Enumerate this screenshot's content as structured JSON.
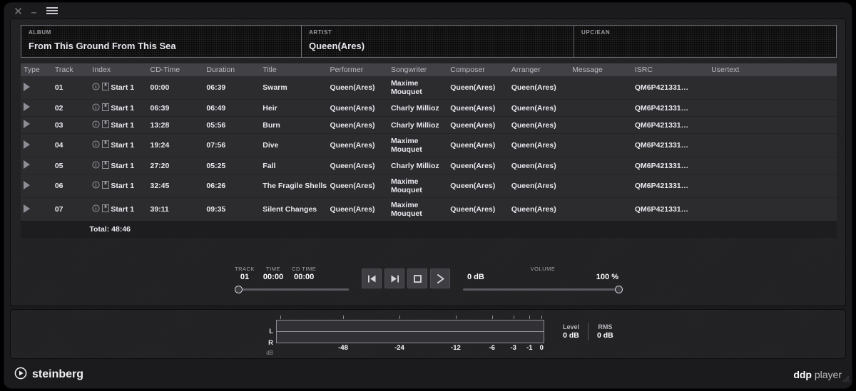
{
  "titlebar": {
    "close_icon": "close-icon",
    "minimize_icon": "minimize-icon",
    "menu_icon": "hamburger-menu-icon"
  },
  "meta": {
    "album": {
      "label": "ALBUM",
      "value": "From This Ground From This Sea"
    },
    "artist": {
      "label": "ARTIST",
      "value": "Queen(Ares)"
    },
    "upc": {
      "label": "UPC/EAN",
      "value": ""
    }
  },
  "table": {
    "columns": [
      "Type",
      "Track",
      "Index",
      "CD-Time",
      "Duration",
      "Title",
      "Performer",
      "Songwriter",
      "Composer",
      "Arranger",
      "Message",
      "ISRC",
      "Usertext"
    ],
    "rows": [
      {
        "track": "01",
        "index": "Start 1",
        "cdtime": "00:00",
        "duration": "06:39",
        "title": "Swarm",
        "performer": "Queen(Ares)",
        "songwriter": "Maxime Mouquet",
        "composer": "Queen(Ares)",
        "arranger": "Queen(Ares)",
        "message": "",
        "isrc": "QM6P421331…",
        "usertext": ""
      },
      {
        "track": "02",
        "index": "Start 1",
        "cdtime": "06:39",
        "duration": "06:49",
        "title": "Heir",
        "performer": "Queen(Ares)",
        "songwriter": "Charly Millioz",
        "composer": "Queen(Ares)",
        "arranger": "Queen(Ares)",
        "message": "",
        "isrc": "QM6P421331…",
        "usertext": ""
      },
      {
        "track": "03",
        "index": "Start 1",
        "cdtime": "13:28",
        "duration": "05:56",
        "title": "Burn",
        "performer": "Queen(Ares)",
        "songwriter": "Charly Millioz",
        "composer": "Queen(Ares)",
        "arranger": "Queen(Ares)",
        "message": "",
        "isrc": "QM6P421331…",
        "usertext": ""
      },
      {
        "track": "04",
        "index": "Start 1",
        "cdtime": "19:24",
        "duration": "07:56",
        "title": "Dive",
        "performer": "Queen(Ares)",
        "songwriter": "Maxime Mouquet",
        "composer": "Queen(Ares)",
        "arranger": "Queen(Ares)",
        "message": "",
        "isrc": "QM6P421331…",
        "usertext": ""
      },
      {
        "track": "05",
        "index": "Start 1",
        "cdtime": "27:20",
        "duration": "05:25",
        "title": "Fall",
        "performer": "Queen(Ares)",
        "songwriter": "Charly Millioz",
        "composer": "Queen(Ares)",
        "arranger": "Queen(Ares)",
        "message": "",
        "isrc": "QM6P421331…",
        "usertext": ""
      },
      {
        "track": "06",
        "index": "Start 1",
        "cdtime": "32:45",
        "duration": "06:26",
        "title": "The Fragile Shells",
        "performer": "Queen(Ares)",
        "songwriter": "Maxime Mouquet",
        "composer": "Queen(Ares)",
        "arranger": "Queen(Ares)",
        "message": "",
        "isrc": "QM6P421331…",
        "usertext": ""
      },
      {
        "track": "07",
        "index": "Start 1",
        "cdtime": "39:11",
        "duration": "09:35",
        "title": "Silent Changes",
        "performer": "Queen(Ares)",
        "songwriter": "Maxime Mouquet",
        "composer": "Queen(Ares)",
        "arranger": "Queen(Ares)",
        "message": "",
        "isrc": "QM6P421331…",
        "usertext": ""
      }
    ],
    "total_label": "Total: 48:46"
  },
  "transport": {
    "track_caption": "TRACK",
    "track_value": "01",
    "time_caption": "TIME",
    "time_value": "00:00",
    "cdtime_caption": "CD TIME",
    "cdtime_value": "00:00",
    "position_percent": 0,
    "buttons": [
      {
        "name": "previous-track-button",
        "icon": "skip-back-icon"
      },
      {
        "name": "next-track-button",
        "icon": "skip-forward-icon"
      },
      {
        "name": "stop-button",
        "icon": "stop-icon"
      },
      {
        "name": "play-button",
        "icon": "play-icon"
      }
    ],
    "volume_caption": "VOLUME",
    "volume_db": "0 dB",
    "volume_percent": "100 %",
    "volume_knob_percent": 100
  },
  "meter": {
    "channel_l": "L",
    "channel_r": "R",
    "unit": "dB",
    "scale": [
      "-48",
      "-24",
      "-12",
      "-6",
      "-3",
      "-1",
      "0"
    ],
    "scale_positions": [
      25,
      46,
      67,
      80.5,
      88.5,
      94.5,
      99
    ],
    "tick_positions": [
      1.5,
      25,
      46,
      67,
      80.5,
      88.5,
      94.5,
      99
    ],
    "level_caption": "Level",
    "level_value": "0 dB",
    "rms_caption": "RMS",
    "rms_value": "0 dB",
    "l_level_percent": 0,
    "r_level_percent": 0
  },
  "footer": {
    "brand": "steinberg",
    "product_bold": "ddp",
    "product_light": " player"
  },
  "colors": {
    "window_bg": "#1b1b1d",
    "panel_bg": "#232325",
    "table_header": "#414146",
    "table_row": "#2c2c2f",
    "text": "#e8e8ee",
    "muted_text": "#9b9ba2",
    "field_border": "#6d6d74"
  }
}
